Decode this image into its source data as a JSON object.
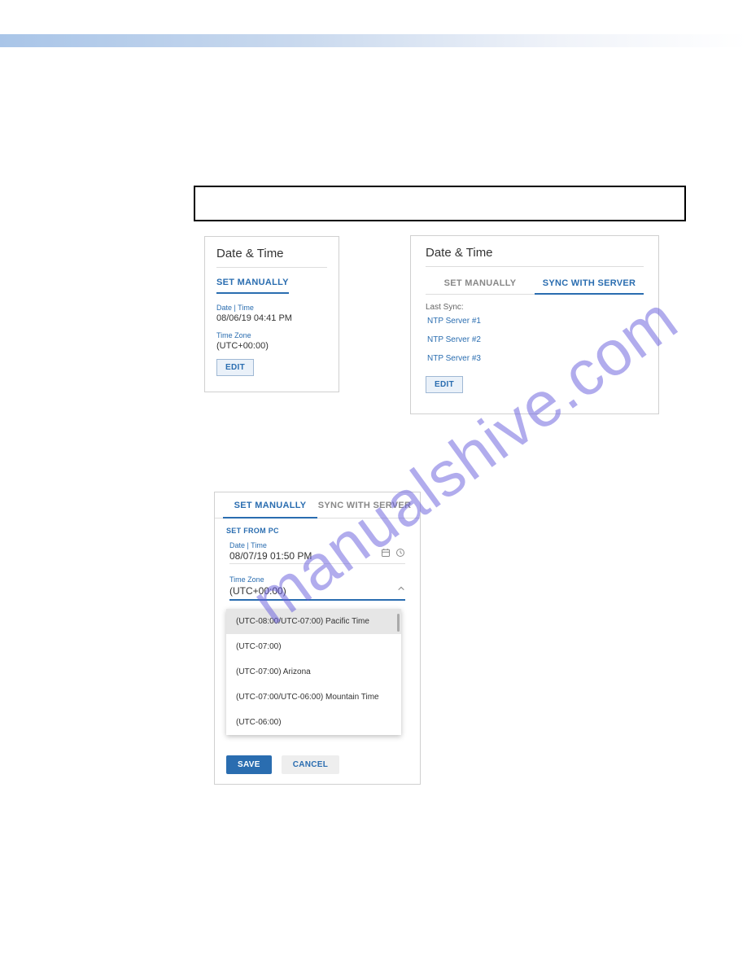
{
  "watermark": "manualshive.com",
  "card1": {
    "title": "Date & Time",
    "tab": "SET MANUALLY",
    "date_label": "Date | Time",
    "date_value": "08/06/19 04:41 PM",
    "tz_label": "Time Zone",
    "tz_value": "(UTC+00:00)",
    "edit_label": "EDIT"
  },
  "card2": {
    "title": "Date & Time",
    "tab_manual": "SET MANUALLY",
    "tab_sync": "SYNC WITH SERVER",
    "last_sync_label": "Last Sync:",
    "ntp1": "NTP Server #1",
    "ntp2": "NTP Server #2",
    "ntp3": "NTP Server #3",
    "edit_label": "EDIT"
  },
  "card3": {
    "tab_manual": "SET MANUALLY",
    "tab_sync": "SYNC WITH SERVER",
    "set_from_pc": "SET FROM PC",
    "date_label": "Date | Time",
    "date_value": "08/07/19 01:50 PM",
    "tz_label": "Time Zone",
    "tz_value": "(UTC+00:00)",
    "dropdown": [
      "(UTC-08:00/UTC-07:00) Pacific Time",
      "(UTC-07:00)",
      "(UTC-07:00) Arizona",
      "(UTC-07:00/UTC-06:00) Mountain Time",
      "(UTC-06:00)"
    ],
    "save_label": "SAVE",
    "cancel_label": "CANCEL"
  }
}
